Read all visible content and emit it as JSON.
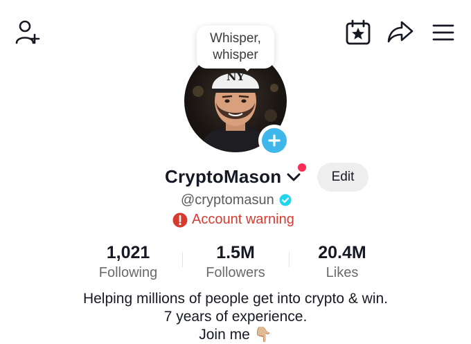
{
  "header": {
    "icons": [
      "add-friend-icon",
      "calendar-star-icon",
      "share-icon",
      "menu-icon"
    ]
  },
  "tooltip": {
    "line1": "Whisper,",
    "line2": "whisper"
  },
  "profile": {
    "username": "CryptoMason",
    "handle": "@cryptomasun",
    "edit_label": "Edit",
    "warning": "Account warning"
  },
  "stats": [
    {
      "value": "1,021",
      "label": "Following"
    },
    {
      "value": "1.5M",
      "label": "Followers"
    },
    {
      "value": "20.4M",
      "label": "Likes"
    }
  ],
  "bio": {
    "line1": "Helping millions of people get into crypto & win.",
    "line2": "7 years of experience.",
    "line3": "Join me 👇🏼"
  },
  "colors": {
    "accent_red": "#fe2c55",
    "warning_red": "#d63b2f",
    "verified_blue": "#20d5ec",
    "add_blue": "#3fb7ea"
  }
}
